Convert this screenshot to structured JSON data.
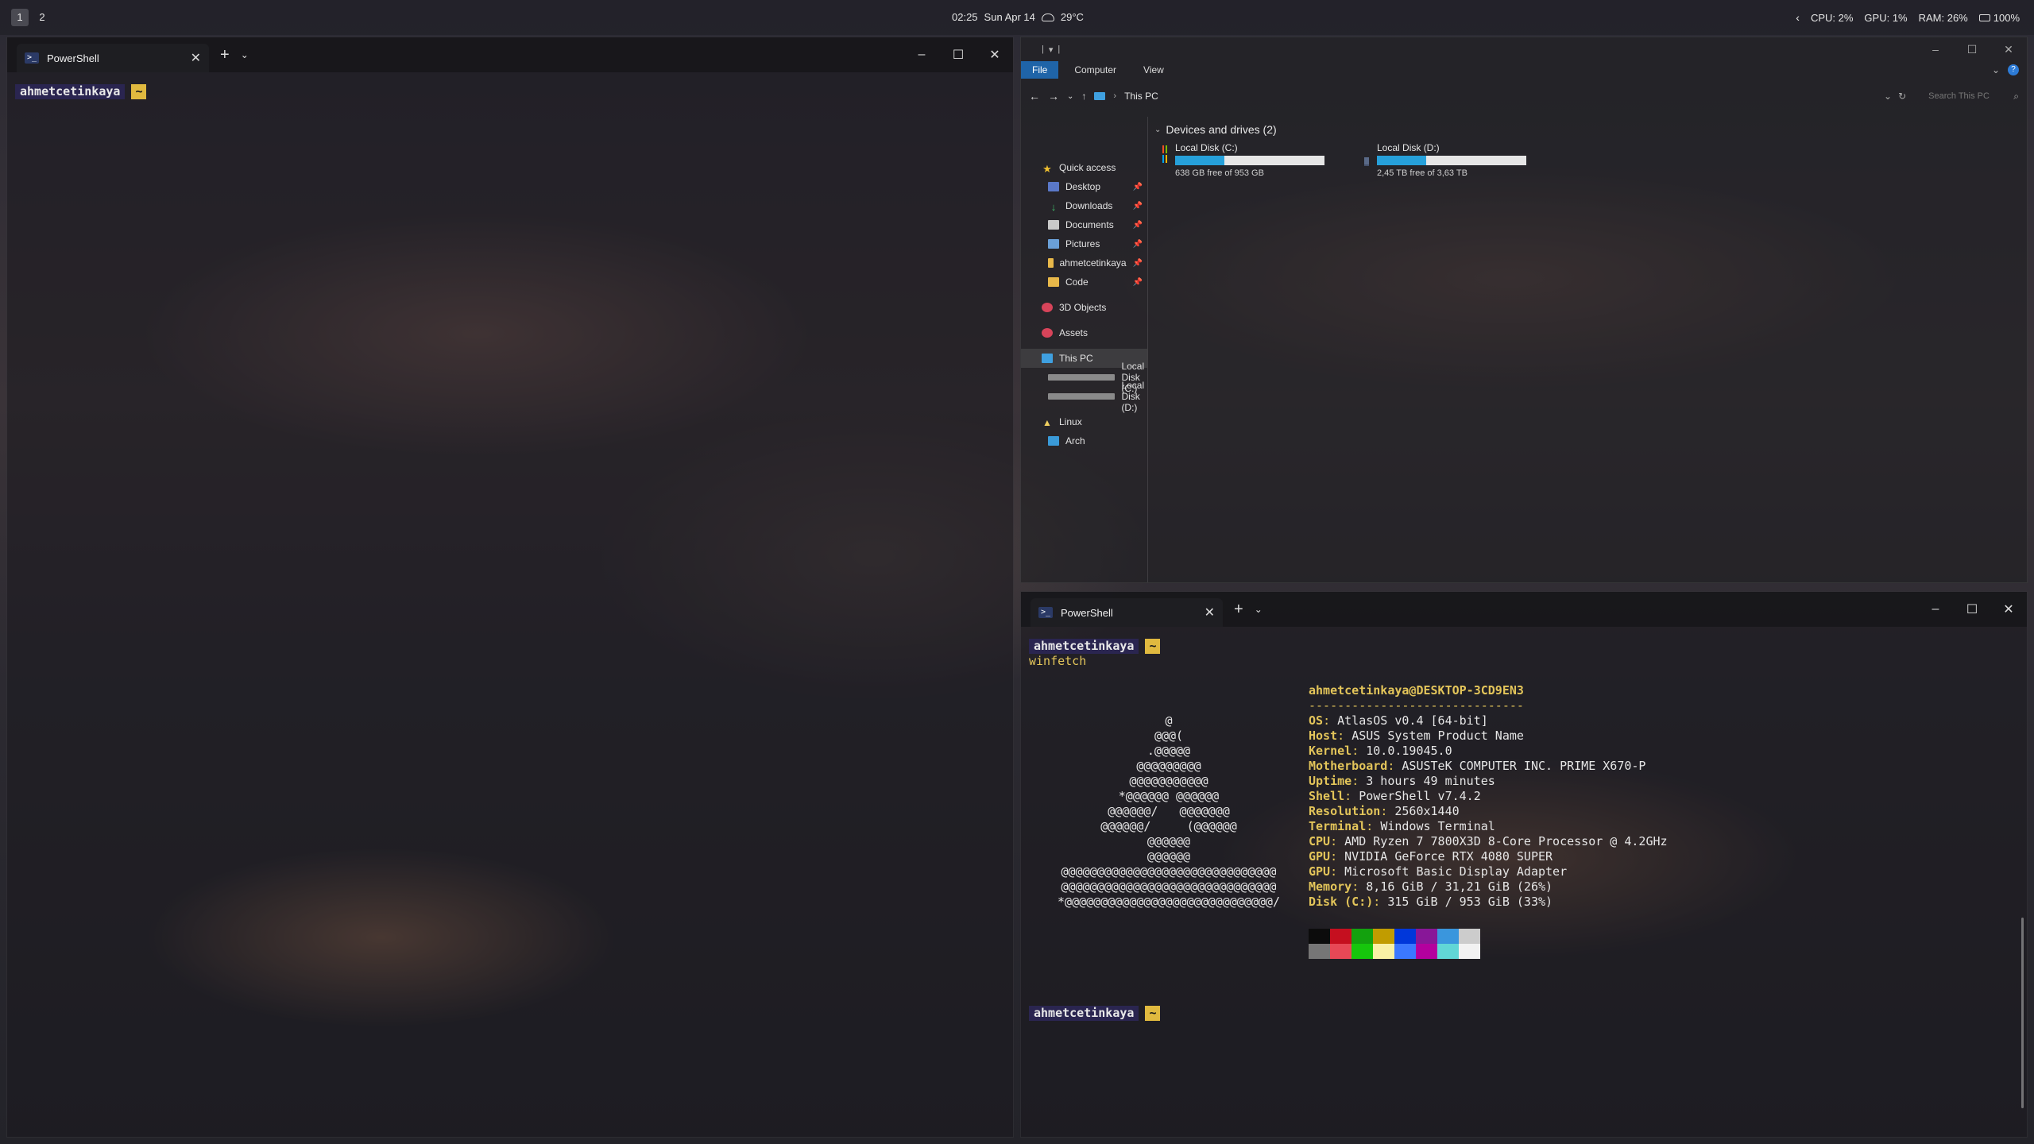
{
  "topbar": {
    "workspaces": [
      "1",
      "2"
    ],
    "time": "02:25",
    "date": "Sun Apr 14",
    "weather": "29°C",
    "cpu": "CPU: 2%",
    "gpu": "GPU: 1%",
    "ram": "RAM: 26%",
    "battery": "100%"
  },
  "left_terminal": {
    "tab_title": "PowerShell",
    "prompt_user": "ahmetcetinkaya",
    "prompt_dir": "~"
  },
  "right_terminal": {
    "tab_title": "PowerShell",
    "prompt_user": "ahmetcetinkaya",
    "prompt_dir": "~",
    "command": "winfetch",
    "logo_lines": [
      "@",
      "@@@(",
      ".@@@@@",
      "@@@@@@@@@",
      "@@@@@@@@@@@",
      "*@@@@@@ @@@@@@",
      "@@@@@@/   @@@@@@@",
      "@@@@@@/     (@@@@@@",
      "@@@@@@",
      "@@@@@@",
      "@@@@@@@@@@@@@@@@@@@@@@@@@@@@@@",
      "@@@@@@@@@@@@@@@@@@@@@@@@@@@@@@",
      "*@@@@@@@@@@@@@@@@@@@@@@@@@@@@@/"
    ],
    "fetch_title": "ahmetcetinkaya@DESKTOP-3CD9EN3",
    "fetch_separator": "------------------------------",
    "fetch_rows": [
      {
        "key": "OS",
        "value": "AtlasOS v0.4 [64-bit]"
      },
      {
        "key": "Host",
        "value": "ASUS System Product Name"
      },
      {
        "key": "Kernel",
        "value": "10.0.19045.0"
      },
      {
        "key": "Motherboard",
        "value": "ASUSTeK COMPUTER INC. PRIME X670-P"
      },
      {
        "key": "Uptime",
        "value": "3 hours 49 minutes"
      },
      {
        "key": "Shell",
        "value": "PowerShell v7.4.2"
      },
      {
        "key": "Resolution",
        "value": "2560x1440"
      },
      {
        "key": "Terminal",
        "value": "Windows Terminal"
      },
      {
        "key": "CPU",
        "value": "AMD Ryzen 7 7800X3D 8-Core Processor @ 4.2GHz"
      },
      {
        "key": "GPU",
        "value": "NVIDIA GeForce RTX 4080 SUPER"
      },
      {
        "key": "GPU",
        "value": "Microsoft Basic Display Adapter"
      },
      {
        "key": "Memory",
        "value": "8,16 GiB / 31,21 GiB (26%)"
      },
      {
        "key": "Disk (C:)",
        "value": "315 GiB / 953 GiB (33%)"
      }
    ],
    "palette_top": [
      "#0c0c0c",
      "#c50f1f",
      "#13a10e",
      "#c19c00",
      "#0037da",
      "#881798",
      "#3a96dd",
      "#cccccc"
    ],
    "palette_bottom": [
      "#767676",
      "#e74856",
      "#16c60c",
      "#f9f1a5",
      "#3b78ff",
      "#b4009e",
      "#61d6d6",
      "#f2f2f2"
    ]
  },
  "explorer": {
    "ribbon_tabs": [
      "File",
      "Computer",
      "View"
    ],
    "breadcrumb": "This PC",
    "search_placeholder": "Search This PC",
    "section_title": "Devices and drives (2)",
    "nav": {
      "quick_access": "Quick access",
      "pinned": [
        "Desktop",
        "Downloads",
        "Documents",
        "Pictures",
        "ahmetcetinkaya",
        "Code"
      ],
      "objects_3d": "3D Objects",
      "assets": "Assets",
      "this_pc": "This PC",
      "drives": [
        "Local Disk (C:)",
        "Local Disk (D:)"
      ],
      "linux": "Linux",
      "arch": "Arch"
    },
    "drives": [
      {
        "name": "Local Disk (C:)",
        "free_text": "638 GB free of 953 GB",
        "used_fraction": 0.33
      },
      {
        "name": "Local Disk (D:)",
        "free_text": "2,45 TB free of 3,63 TB",
        "used_fraction": 0.33
      }
    ]
  },
  "colors": {
    "prompt_user_bg": "#2a2550",
    "prompt_dir_bg": "#e0b93f",
    "fetch_key": "#e3c55a",
    "accent_blue": "#1f64a8",
    "drive_fill": "#26a0da"
  }
}
